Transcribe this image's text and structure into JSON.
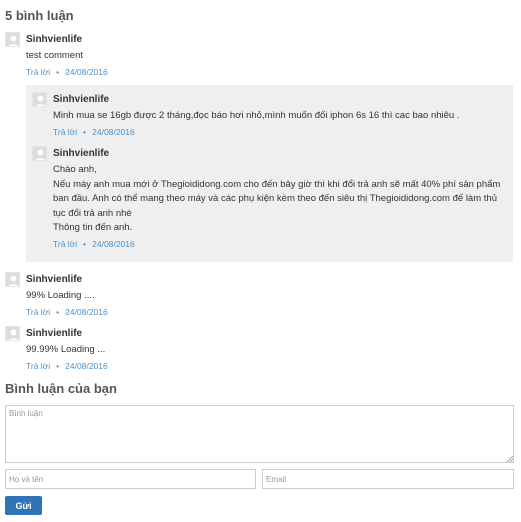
{
  "comments_header": "5 bình luận",
  "comments": [
    {
      "author": "Sinhvienlife",
      "lines": [
        "test comment"
      ],
      "reply_label": "Trả lời",
      "date": "24/08/2016",
      "replies": [
        {
          "author": "Sinhvienlife",
          "lines": [
            "Minh mua se 16gb được 2 tháng,đọc báo hơi nhỏ,mình muốn đổi iphon 6s 16 thì cac bao nhiêu ."
          ],
          "reply_label": "Trả lời",
          "date": "24/08/2016"
        },
        {
          "author": "Sinhvienlife",
          "lines": [
            "Chào anh,",
            "Nếu máy anh mua mới ở Thegioididong.com cho đến bây giờ thì khi đổi trả anh sẽ mất 40% phí sản phẩm",
            "ban đầu. Anh có thể mang theo máy và các phụ kiện kèm theo đến siêu thị Thegioididong.com để làm thủ",
            "tục đổi trả anh nhé",
            "Thông tin đến anh."
          ],
          "reply_label": "Trả lời",
          "date": "24/08/2016"
        }
      ]
    },
    {
      "author": "Sinhvienlife",
      "lines": [
        "99% Loading ...."
      ],
      "reply_label": "Trả lời",
      "date": "24/08/2016"
    },
    {
      "author": "Sinhvienlife",
      "lines": [
        "99.99% Loading ..."
      ],
      "reply_label": "Trả lời",
      "date": "24/08/2016"
    }
  ],
  "form": {
    "title": "Bình luận của bạn",
    "comment_placeholder": "Bình luận",
    "name_placeholder": "Họ và tên",
    "email_placeholder": "Email",
    "submit_label": "Gửi"
  },
  "colors": {
    "link": "#4a90c9",
    "button": "#2f73b8",
    "reply_background": "#efefef"
  }
}
